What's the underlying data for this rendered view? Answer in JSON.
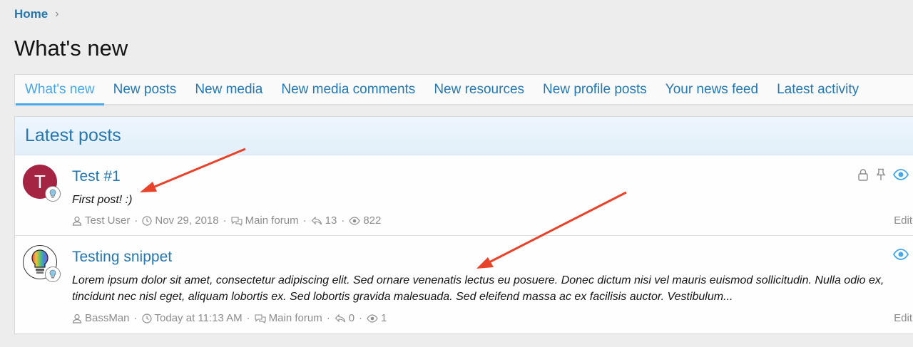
{
  "breadcrumb": {
    "home": "Home",
    "chevron": "›"
  },
  "page": {
    "title": "What's new"
  },
  "tabs": [
    {
      "label": "What's new",
      "active": true
    },
    {
      "label": "New posts"
    },
    {
      "label": "New media"
    },
    {
      "label": "New media comments"
    },
    {
      "label": "New resources"
    },
    {
      "label": "New profile posts"
    },
    {
      "label": "Your news feed"
    },
    {
      "label": "Latest activity"
    }
  ],
  "block": {
    "title": "Latest posts"
  },
  "posts": [
    {
      "avatar_letter": "T",
      "title": "Test #1",
      "snippet": "First post! :)",
      "author": "Test User",
      "date": "Nov 29, 2018",
      "forum": "Main forum",
      "replies": "13",
      "views": "822",
      "edit": "Edit",
      "status_icons": [
        "lock-icon",
        "pin-icon",
        "eye-icon"
      ]
    },
    {
      "avatar_icon": "lightbulb-icon",
      "title": "Testing snippet",
      "snippet": "Lorem ipsum dolor sit amet, consectetur adipiscing elit. Sed ornare venenatis lectus eu posuere. Donec dictum nisi vel mauris euismod sollicitudin. Nulla odio ex, tincidunt nec nisl eget, aliquam lobortis ex. Sed lobortis gravida malesuada. Sed eleifend massa ac ex facilisis auctor. Vestibulum...",
      "author": "BassMan",
      "date": "Today at 11:13 AM",
      "forum": "Main forum",
      "replies": "0",
      "views": "1",
      "edit": "Edit",
      "status_icons": [
        "eye-icon"
      ]
    }
  ],
  "colors": {
    "link": "#2577b1",
    "active_tab": "#47a7eb",
    "annotation_arrow": "#e8432a",
    "avatar_bg": "#a52343"
  }
}
